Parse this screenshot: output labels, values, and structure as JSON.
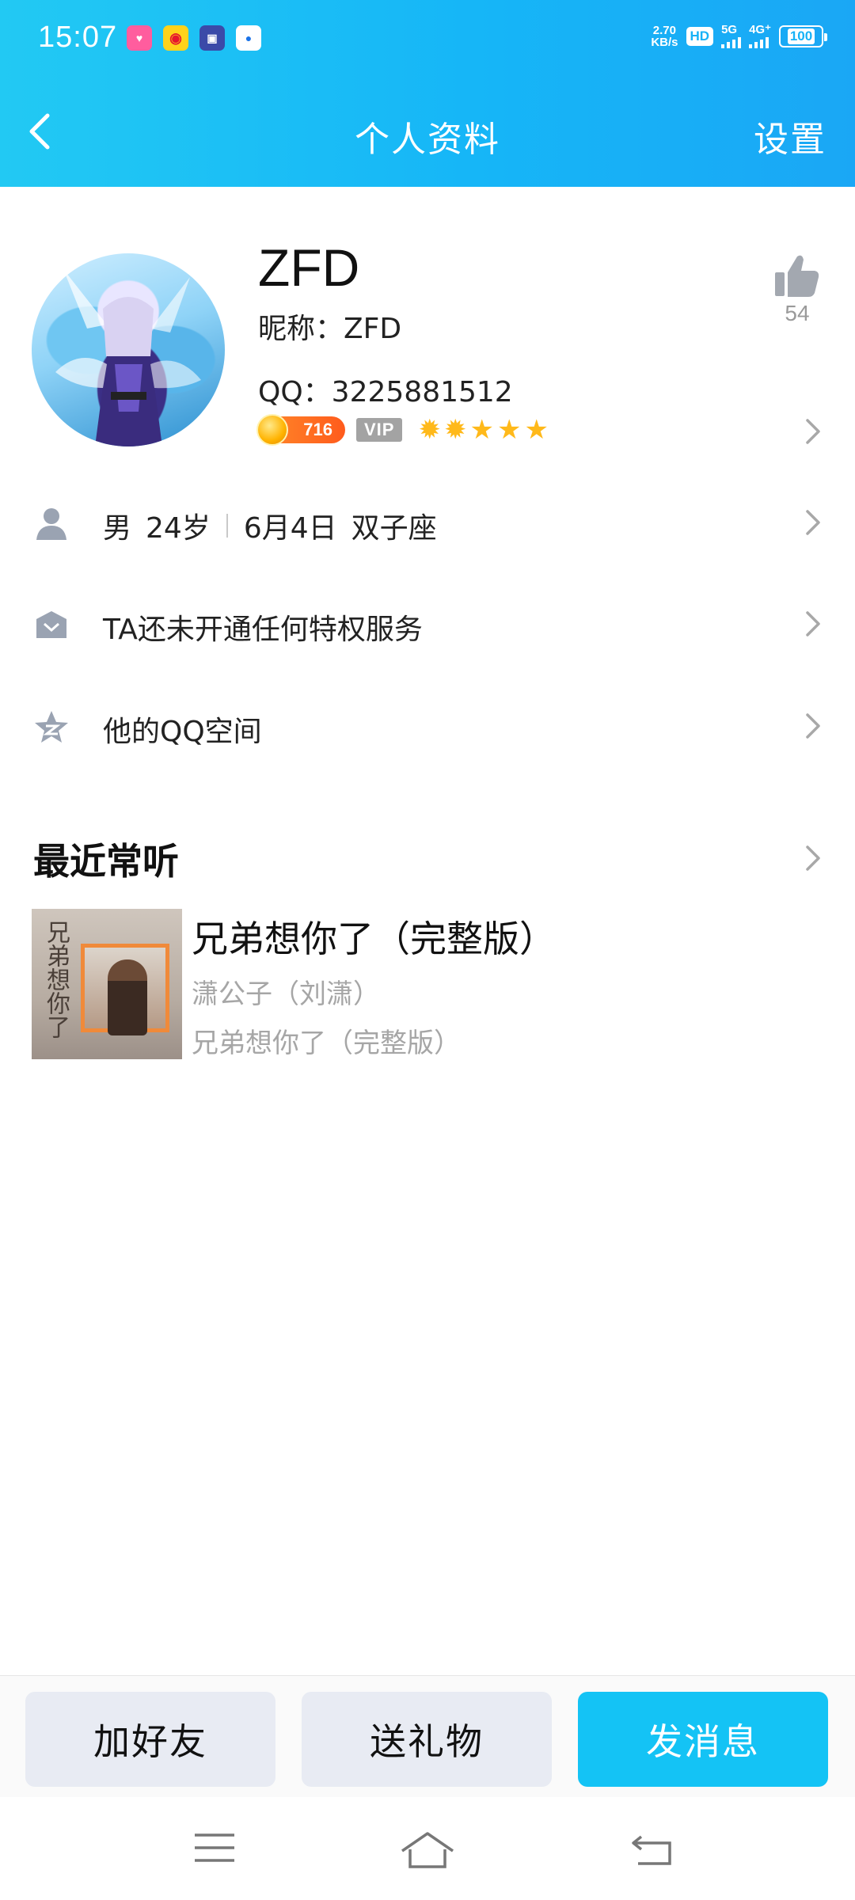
{
  "status_bar": {
    "time": "15:07",
    "net_speed_value": "2.70",
    "net_speed_unit": "KB/s",
    "hd_label": "HD",
    "sim1_label": "5G",
    "sim2_label": "4G⁺",
    "battery": "100",
    "apps": [
      "lolo-app-icon",
      "weibo-icon",
      "navy-app-icon",
      "blue-app-icon"
    ]
  },
  "header": {
    "title": "个人资料",
    "settings_label": "设置"
  },
  "profile": {
    "name": "ZFD",
    "nickname": "昵称：ZFD",
    "qq": "QQ：3225881512",
    "level": "716",
    "vip_label": "VIP",
    "likes": "54"
  },
  "info_rows": {
    "gender": "男",
    "age": "24岁",
    "birthday": "6月4日",
    "zodiac": "双子座",
    "privilege": "TA还未开通任何特权服务",
    "qzone": "他的QQ空间"
  },
  "recent_music": {
    "section_title": "最近常听",
    "song_title": "兄弟想你了（完整版）",
    "artist": "潇公子（刘潇）",
    "album": "兄弟想你了（完整版）",
    "album_art_text": "兄弟想你了"
  },
  "actions": {
    "add_friend": "加好友",
    "send_gift": "送礼物",
    "send_message": "发消息"
  },
  "colors": {
    "header_gradient_start": "#22c9f3",
    "header_gradient_end": "#1aa7f5",
    "primary_button": "#14c3f5",
    "secondary_button": "#e8ebf3",
    "muted_text": "#a6a6a6"
  }
}
